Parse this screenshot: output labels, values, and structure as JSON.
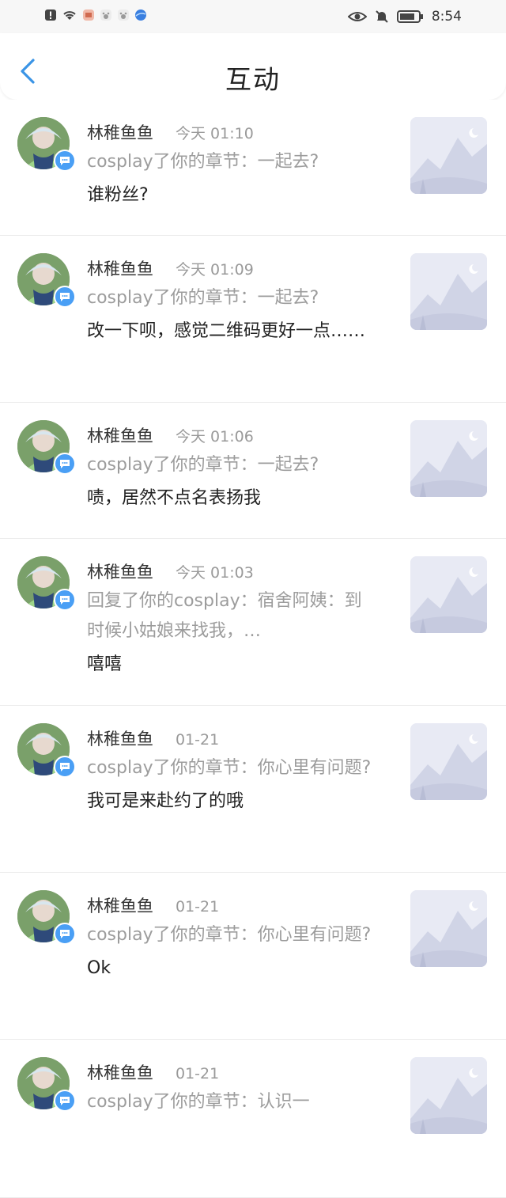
{
  "status_bar": {
    "time": "8:54",
    "left_icons": [
      "alert-icon",
      "wifi-icon",
      "app-icon",
      "paw-icon",
      "paw-icon",
      "globe-icon"
    ],
    "right_icons": [
      "eye-icon",
      "mute-icon",
      "battery-icon"
    ]
  },
  "header": {
    "title": "互动",
    "back_icon": "chevron-left-icon"
  },
  "colors": {
    "accent": "#4a9ff5",
    "back": "#3a94e6",
    "meta": "#999999"
  },
  "items": [
    {
      "name": "林稚鱼鱼",
      "time": "今天 01:10",
      "ref": "cosplay了你的章节：一起去?",
      "reply": "谁粉丝?"
    },
    {
      "name": "林稚鱼鱼",
      "time": "今天 01:09",
      "ref": "cosplay了你的章节：一起去?",
      "reply": "改一下呗，感觉二维码更好一点……"
    },
    {
      "name": "林稚鱼鱼",
      "time": "今天 01:06",
      "ref": "cosplay了你的章节：一起去?",
      "reply": "啧，居然不点名表扬我"
    },
    {
      "name": "林稚鱼鱼",
      "time": "今天 01:03",
      "ref": "回复了你的cosplay：宿舍阿姨：到时候小姑娘来找我，…",
      "reply": "嘻嘻"
    },
    {
      "name": "林稚鱼鱼",
      "time": "01-21",
      "ref": "cosplay了你的章节：你心里有问题?",
      "reply": "我可是来赴约了的哦"
    },
    {
      "name": "林稚鱼鱼",
      "time": "01-21",
      "ref": "cosplay了你的章节：你心里有问题?",
      "reply": "Ok"
    },
    {
      "name": "林稚鱼鱼",
      "time": "01-21",
      "ref": "cosplay了你的章节：认识一",
      "reply": ""
    }
  ]
}
